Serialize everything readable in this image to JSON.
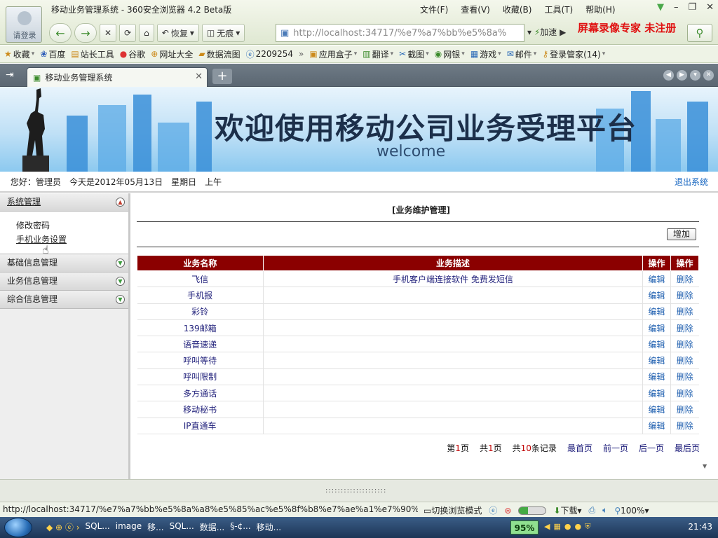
{
  "browser": {
    "window_title": "移动业务管理系统 - 360安全浏览器 4.2 Beta版",
    "avatar_label": "请登录",
    "menus": [
      "文件(F)",
      "查看(V)",
      "收藏(B)",
      "工具(T)",
      "帮助(H)"
    ],
    "toolbar": {
      "restore_label": "恢复",
      "no_trace_label": "无痕",
      "speed_label": "加速"
    },
    "address": "http://localhost:34717/%e7%a7%bb%e5%8a%",
    "watermark": "屏幕录像专家  未注册",
    "bookmarks": [
      "收藏",
      "百度",
      "站长工具",
      "谷歌",
      "网址大全",
      "数据流图",
      "2209254",
      "应用盒子",
      "翻译",
      "截图",
      "网银",
      "游戏",
      "邮件",
      "登录管家(14)"
    ],
    "tab_title": "移动业务管理系统",
    "status_url": "http://localhost:34717/%e7%a7%bb%e5%8a%a8%e5%85%ac%e5%8f%b8%e7%ae%a1%e7%90%8...",
    "status_items": {
      "switch_mode": "切换浏览模式",
      "download": "下载",
      "zoom": "100%"
    }
  },
  "banner": {
    "title": "欢迎使用移动公司业务受理平台",
    "subtitle": "welcome"
  },
  "infobar": {
    "greeting": "您好：管理员",
    "date": "今天是2012年05月13日",
    "weekday": "星期日",
    "period": "上午",
    "logout": "退出系统"
  },
  "sidebar": {
    "sections": [
      {
        "title": "系统管理",
        "open": true,
        "items": [
          "修改密码",
          "手机业务设置"
        ]
      },
      {
        "title": "基础信息管理",
        "open": false
      },
      {
        "title": "业务信息管理",
        "open": false
      },
      {
        "title": "综合信息管理",
        "open": false
      }
    ]
  },
  "main": {
    "title": "[业务维护管理]",
    "add_button": "增加",
    "columns": [
      "业务名称",
      "业务描述",
      "操作",
      "操作"
    ],
    "rows": [
      {
        "name": "飞信",
        "desc": "手机客户端连接软件 免费发短信",
        "edit": "编辑",
        "del": "删除"
      },
      {
        "name": "手机报",
        "desc": "",
        "edit": "编辑",
        "del": "删除"
      },
      {
        "name": "彩铃",
        "desc": "",
        "edit": "编辑",
        "del": "删除"
      },
      {
        "name": "139邮箱",
        "desc": "",
        "edit": "编辑",
        "del": "删除"
      },
      {
        "name": "语音速递",
        "desc": "",
        "edit": "编辑",
        "del": "删除"
      },
      {
        "name": "呼叫等待",
        "desc": "",
        "edit": "编辑",
        "del": "删除"
      },
      {
        "name": "呼叫限制",
        "desc": "",
        "edit": "编辑",
        "del": "删除"
      },
      {
        "name": "多方通话",
        "desc": "",
        "edit": "编辑",
        "del": "删除"
      },
      {
        "name": "移动秘书",
        "desc": "",
        "edit": "编辑",
        "del": "删除"
      },
      {
        "name": "IP直通车",
        "desc": "",
        "edit": "编辑",
        "del": "删除"
      }
    ],
    "pager": {
      "page_prefix": "第",
      "page_value": "1",
      "page_suffix": "页",
      "total_prefix": "共",
      "total_value": "1",
      "total_suffix": "页",
      "records_prefix": "共",
      "records_value": "10",
      "records_suffix": "条记录",
      "first": "最首页",
      "prev": "前一页",
      "next": "后一页",
      "last": "最后页"
    }
  },
  "taskbar": {
    "items": [
      "SQL...",
      "image",
      "移...",
      "SQL...",
      "数据...",
      "§-¢...",
      "移动..."
    ],
    "battery": "95%",
    "clock": "21:43"
  },
  "colors": {
    "table_header": "#8b0000",
    "watermark": "#e01010",
    "link_blue": "#1565c0"
  }
}
